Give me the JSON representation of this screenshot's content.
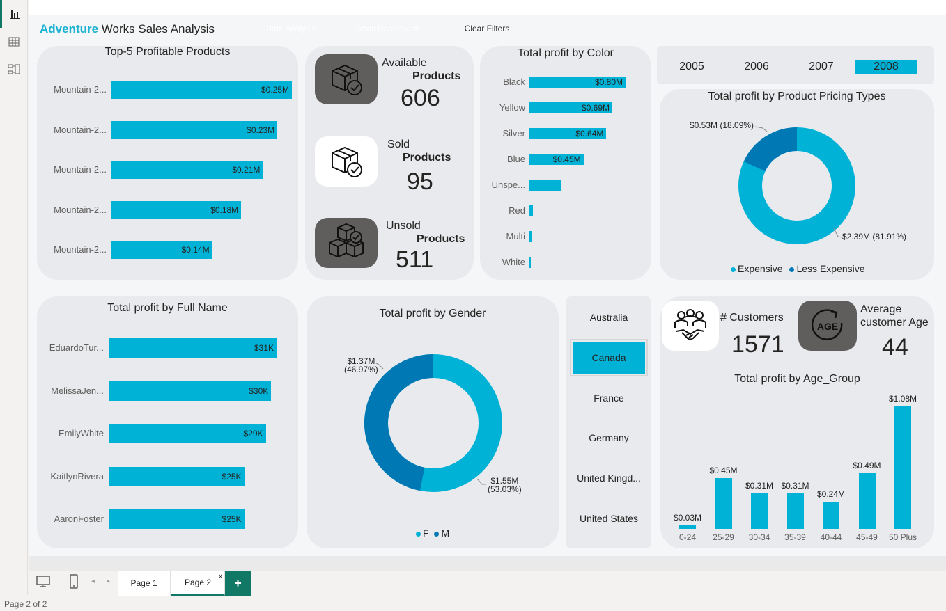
{
  "header": {
    "title_accent": "Adventure",
    "title_rest": " Works Sales Analysis",
    "buttons": [
      {
        "label": "Time Analysis",
        "color": "#605e5c"
      },
      {
        "label": "Detail Dashboard",
        "color": "#b3b0ad"
      },
      {
        "label": "Clear Filters",
        "color": "#f04e0c"
      }
    ]
  },
  "top_products": {
    "title": "Top-5 Profitable Products",
    "items": [
      {
        "name": "Mountain-2...",
        "value": 0.25,
        "label": "$0.25M"
      },
      {
        "name": "Mountain-2...",
        "value": 0.23,
        "label": "$0.23M"
      },
      {
        "name": "Mountain-2...",
        "value": 0.21,
        "label": "$0.21M"
      },
      {
        "name": "Mountain-2...",
        "value": 0.18,
        "label": "$0.18M"
      },
      {
        "name": "Mountain-2...",
        "value": 0.14,
        "label": "$0.14M"
      }
    ]
  },
  "product_kpis": [
    {
      "icon": "box-check-icon",
      "line1": "Available",
      "line2": "Products",
      "value": "606"
    },
    {
      "icon": "box-check-icon",
      "line1": "Sold",
      "line2": "Products",
      "value": "95"
    },
    {
      "icon": "boxes-stack-icon",
      "line1": "Unsold",
      "line2": "Products",
      "value": "511"
    }
  ],
  "profit_by_color": {
    "title": "Total profit by Color",
    "items": [
      {
        "name": "Black",
        "value": 0.8,
        "label": "$0.80M"
      },
      {
        "name": "Yellow",
        "value": 0.69,
        "label": "$0.69M"
      },
      {
        "name": "Silver",
        "value": 0.64,
        "label": "$0.64M"
      },
      {
        "name": "Blue",
        "value": 0.45,
        "label": "$0.45M"
      },
      {
        "name": "Unspe...",
        "value": 0.26,
        "label": ""
      },
      {
        "name": "Red",
        "value": 0.03,
        "label": ""
      },
      {
        "name": "Multi",
        "value": 0.025,
        "label": ""
      },
      {
        "name": "White",
        "value": 0.005,
        "label": ""
      }
    ]
  },
  "years": {
    "items": [
      "2005",
      "2006",
      "2007",
      "2008"
    ],
    "selected": "2008"
  },
  "pricing": {
    "title": "Total profit by Product Pricing Types",
    "label_less": "$0.53M (18.09%)",
    "label_exp": "$2.39M (81.91%)",
    "legend": [
      "Expensive",
      "Less Expensive"
    ]
  },
  "profit_by_name": {
    "title": "Total profit by Full Name",
    "items": [
      {
        "name": "EduardoTur...",
        "value": 31,
        "label": "$31K"
      },
      {
        "name": "MelissaJen...",
        "value": 30,
        "label": "$30K"
      },
      {
        "name": "EmilyWhite",
        "value": 29,
        "label": "$29K"
      },
      {
        "name": "KaitlynRivera",
        "value": 25,
        "label": "$25K"
      },
      {
        "name": "AaronFoster",
        "value": 25,
        "label": "$25K"
      }
    ]
  },
  "gender": {
    "title": "Total profit by Gender",
    "label_m_1": "$1.37M",
    "label_m_2": "(46.97%)",
    "label_f_1": "$1.55M",
    "label_f_2": "(53.03%)",
    "legend": [
      "F",
      "M"
    ]
  },
  "countries": {
    "items": [
      "Australia",
      "Canada",
      "France",
      "Germany",
      "United Kingd...",
      "United States"
    ],
    "selected": "Canada"
  },
  "customers": {
    "label": "# Customers",
    "value": "1571",
    "age_label_1": "Average",
    "age_label_2": "customer Age",
    "age_value": "44",
    "age_icon_text": "AGE"
  },
  "age_group": {
    "title": "Total profit by Age_Group",
    "items": [
      {
        "name": "0-24",
        "value": 0.03,
        "label": "$0.03M"
      },
      {
        "name": "25-29",
        "value": 0.45,
        "label": "$0.45M"
      },
      {
        "name": "30-34",
        "value": 0.31,
        "label": "$0.31M"
      },
      {
        "name": "35-39",
        "value": 0.31,
        "label": "$0.31M"
      },
      {
        "name": "40-44",
        "value": 0.24,
        "label": "$0.24M"
      },
      {
        "name": "45-49",
        "value": 0.49,
        "label": "$0.49M"
      },
      {
        "name": "50 Plus",
        "value": 1.08,
        "label": "$1.08M"
      }
    ]
  },
  "chart_data": [
    {
      "type": "bar",
      "title": "Top-5 Profitable Products",
      "categories": [
        "Mountain-2...",
        "Mountain-2...",
        "Mountain-2...",
        "Mountain-2...",
        "Mountain-2..."
      ],
      "values": [
        0.25,
        0.23,
        0.21,
        0.18,
        0.14
      ]
    },
    {
      "type": "bar",
      "title": "Total profit by Color",
      "categories": [
        "Black",
        "Yellow",
        "Silver",
        "Blue",
        "Unspe...",
        "Red",
        "Multi",
        "White"
      ],
      "values": [
        0.8,
        0.69,
        0.64,
        0.45,
        0.26,
        0.03,
        0.025,
        0.005
      ]
    },
    {
      "type": "pie",
      "title": "Total profit by Product Pricing Types",
      "categories": [
        "Expensive",
        "Less Expensive"
      ],
      "values": [
        2.39,
        0.53
      ]
    },
    {
      "type": "bar",
      "title": "Total profit by Full Name",
      "categories": [
        "EduardoTur...",
        "MelissaJen...",
        "EmilyWhite",
        "KaitlynRivera",
        "AaronFoster"
      ],
      "values": [
        31,
        30,
        29,
        25,
        25
      ]
    },
    {
      "type": "pie",
      "title": "Total profit by Gender",
      "categories": [
        "F",
        "M"
      ],
      "values": [
        1.55,
        1.37
      ]
    },
    {
      "type": "bar",
      "title": "Total profit by Age_Group",
      "categories": [
        "0-24",
        "25-29",
        "30-34",
        "35-39",
        "40-44",
        "45-49",
        "50 Plus"
      ],
      "values": [
        0.03,
        0.45,
        0.31,
        0.31,
        0.24,
        0.49,
        1.08
      ]
    }
  ],
  "colors": {
    "accent": "#00b2d6",
    "dark_blue": "#0078b4",
    "panel": "#e8eaed"
  },
  "pages": {
    "tabs": [
      "Page 1",
      "Page 2"
    ],
    "active": "Page 2",
    "add": "+",
    "close": "x",
    "status": "Page 2 of 2"
  }
}
